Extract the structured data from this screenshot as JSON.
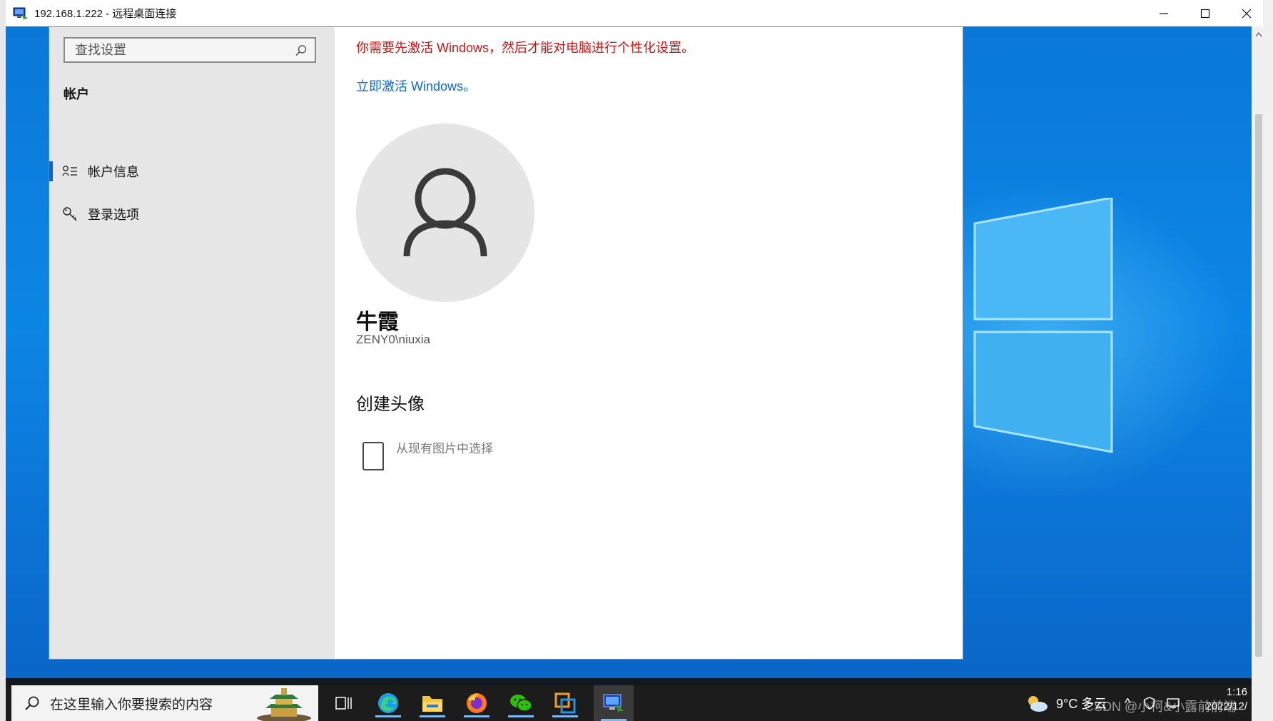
{
  "rdp_window": {
    "title": "192.168.1.222 - 远程桌面连接",
    "minimize_label": "Minimize",
    "maximize_label": "Maximize",
    "close_label": "Close"
  },
  "settings": {
    "search": {
      "placeholder": "查找设置"
    },
    "sidebar_heading": "帐户",
    "nav_items": [
      {
        "label": "帐户信息",
        "icon": "account-info-icon",
        "active": true
      },
      {
        "label": "登录选项",
        "icon": "key-icon",
        "active": false
      }
    ],
    "main": {
      "activation_warning": "你需要先激活 Windows，然后才能对电脑进行个性化设置。",
      "activation_link": "立即激活 Windows。",
      "user_name": "牛霞",
      "user_account": "ZENY0\\niuxia",
      "section_title": "创建头像",
      "pick_photo_label": "从现有图片中选择"
    }
  },
  "taskbar": {
    "search_text": "在这里输入你要搜索的内容",
    "apps": [
      "task-view-icon",
      "edge-icon",
      "file-explorer-icon",
      "firefox-icon",
      "wechat-icon",
      "vmware-icon",
      "remote-desktop-icon"
    ],
    "weather": "9°C  多云",
    "time": "1:16",
    "date": "2022/12/"
  },
  "watermark": "CSDN @小柯&小露前前端",
  "colors": {
    "accent": "#0a64d2",
    "warning_red": "#c81414",
    "link_blue": "#0a6ad4",
    "desktop_blue": "#0c86e6"
  }
}
